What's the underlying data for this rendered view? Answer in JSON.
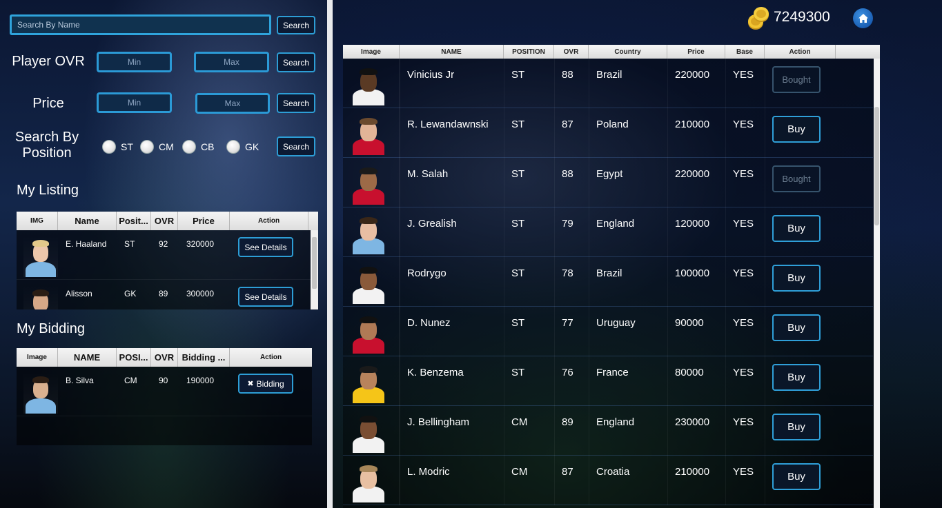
{
  "search_name": {
    "placeholder": "Search By Name",
    "button": "Search"
  },
  "filters": {
    "ovr": {
      "label": "Player OVR",
      "min": "Min",
      "max": "Max",
      "button": "Search"
    },
    "price": {
      "label": "Price",
      "min": "Min",
      "max": "Max",
      "button": "Search"
    },
    "position": {
      "label_line1": "Search By",
      "label_line2": "Position",
      "options": [
        "ST",
        "CM",
        "CB",
        "GK"
      ],
      "button": "Search"
    }
  },
  "my_listing": {
    "title": "My Listing",
    "headers": [
      "IMG",
      "Name",
      "Posit...",
      "OVR",
      "Price",
      "Action"
    ],
    "rows": [
      {
        "name": "E. Haaland",
        "position": "ST",
        "ovr": "92",
        "price": "320000",
        "action": "See Details"
      },
      {
        "name": "Alisson",
        "position": "GK",
        "ovr": "89",
        "price": "300000",
        "action": "See Details"
      }
    ]
  },
  "my_bidding": {
    "title": "My Bidding",
    "headers": [
      "Image",
      "NAME",
      "POSI...",
      "OVR",
      "Bidding ...",
      "Action"
    ],
    "rows": [
      {
        "name": "B. Silva",
        "position": "CM",
        "ovr": "90",
        "bid": "190000",
        "action": "Bidding",
        "action_icon": "✖"
      }
    ]
  },
  "wallet": {
    "balance": "7249300",
    "icon": "coins-icon"
  },
  "home": {
    "icon": "home-icon"
  },
  "market": {
    "headers": [
      "Image",
      "NAME",
      "POSITION",
      "OVR",
      "Country",
      "Price",
      "Base",
      "Action"
    ],
    "rows": [
      {
        "name": "Vinicius Jr",
        "position": "ST",
        "ovr": "88",
        "country": "Brazil",
        "price": "220000",
        "base": "YES",
        "action": "Bought",
        "bought": true,
        "skin": "#5a3a24",
        "shirt": "#f2f2f2",
        "hair": "#111"
      },
      {
        "name": "R. Lewandawnski",
        "position": "ST",
        "ovr": "87",
        "country": "Poland",
        "price": "210000",
        "base": "YES",
        "action": "Buy",
        "bought": false,
        "skin": "#e2b497",
        "shirt": "#c8102e",
        "hair": "#6b4a2e"
      },
      {
        "name": "M. Salah",
        "position": "ST",
        "ovr": "88",
        "country": "Egypt",
        "price": "220000",
        "base": "YES",
        "action": "Bought",
        "bought": true,
        "skin": "#9c6a47",
        "shirt": "#c8102e",
        "hair": "#1a1a1a"
      },
      {
        "name": "J. Grealish",
        "position": "ST",
        "ovr": "79",
        "country": "England",
        "price": "120000",
        "base": "YES",
        "action": "Buy",
        "bought": false,
        "skin": "#e8bea3",
        "shirt": "#7eb6e3",
        "hair": "#3a2718"
      },
      {
        "name": "Rodrygo",
        "position": "ST",
        "ovr": "78",
        "country": "Brazil",
        "price": "100000",
        "base": "YES",
        "action": "Buy",
        "bought": false,
        "skin": "#8a5a3a",
        "shirt": "#f2f2f2",
        "hair": "#111"
      },
      {
        "name": "D. Nunez",
        "position": "ST",
        "ovr": "77",
        "country": "Uruguay",
        "price": "90000",
        "base": "YES",
        "action": "Buy",
        "bought": false,
        "skin": "#b07a55",
        "shirt": "#c8102e",
        "hair": "#111"
      },
      {
        "name": "K. Benzema",
        "position": "ST",
        "ovr": "76",
        "country": "France",
        "price": "80000",
        "base": "YES",
        "action": "Buy",
        "bought": false,
        "skin": "#b8835c",
        "shirt": "#f5c518",
        "hair": "#1a1a1a"
      },
      {
        "name": "J. Bellingham",
        "position": "CM",
        "ovr": "89",
        "country": "England",
        "price": "230000",
        "base": "YES",
        "action": "Buy",
        "bought": false,
        "skin": "#7a4e33",
        "shirt": "#f2f2f2",
        "hair": "#111"
      },
      {
        "name": "L. Modric",
        "position": "CM",
        "ovr": "87",
        "country": "Croatia",
        "price": "210000",
        "base": "YES",
        "action": "Buy",
        "bought": false,
        "skin": "#e8c0a2",
        "shirt": "#f2f2f2",
        "hair": "#a8875a"
      }
    ]
  }
}
